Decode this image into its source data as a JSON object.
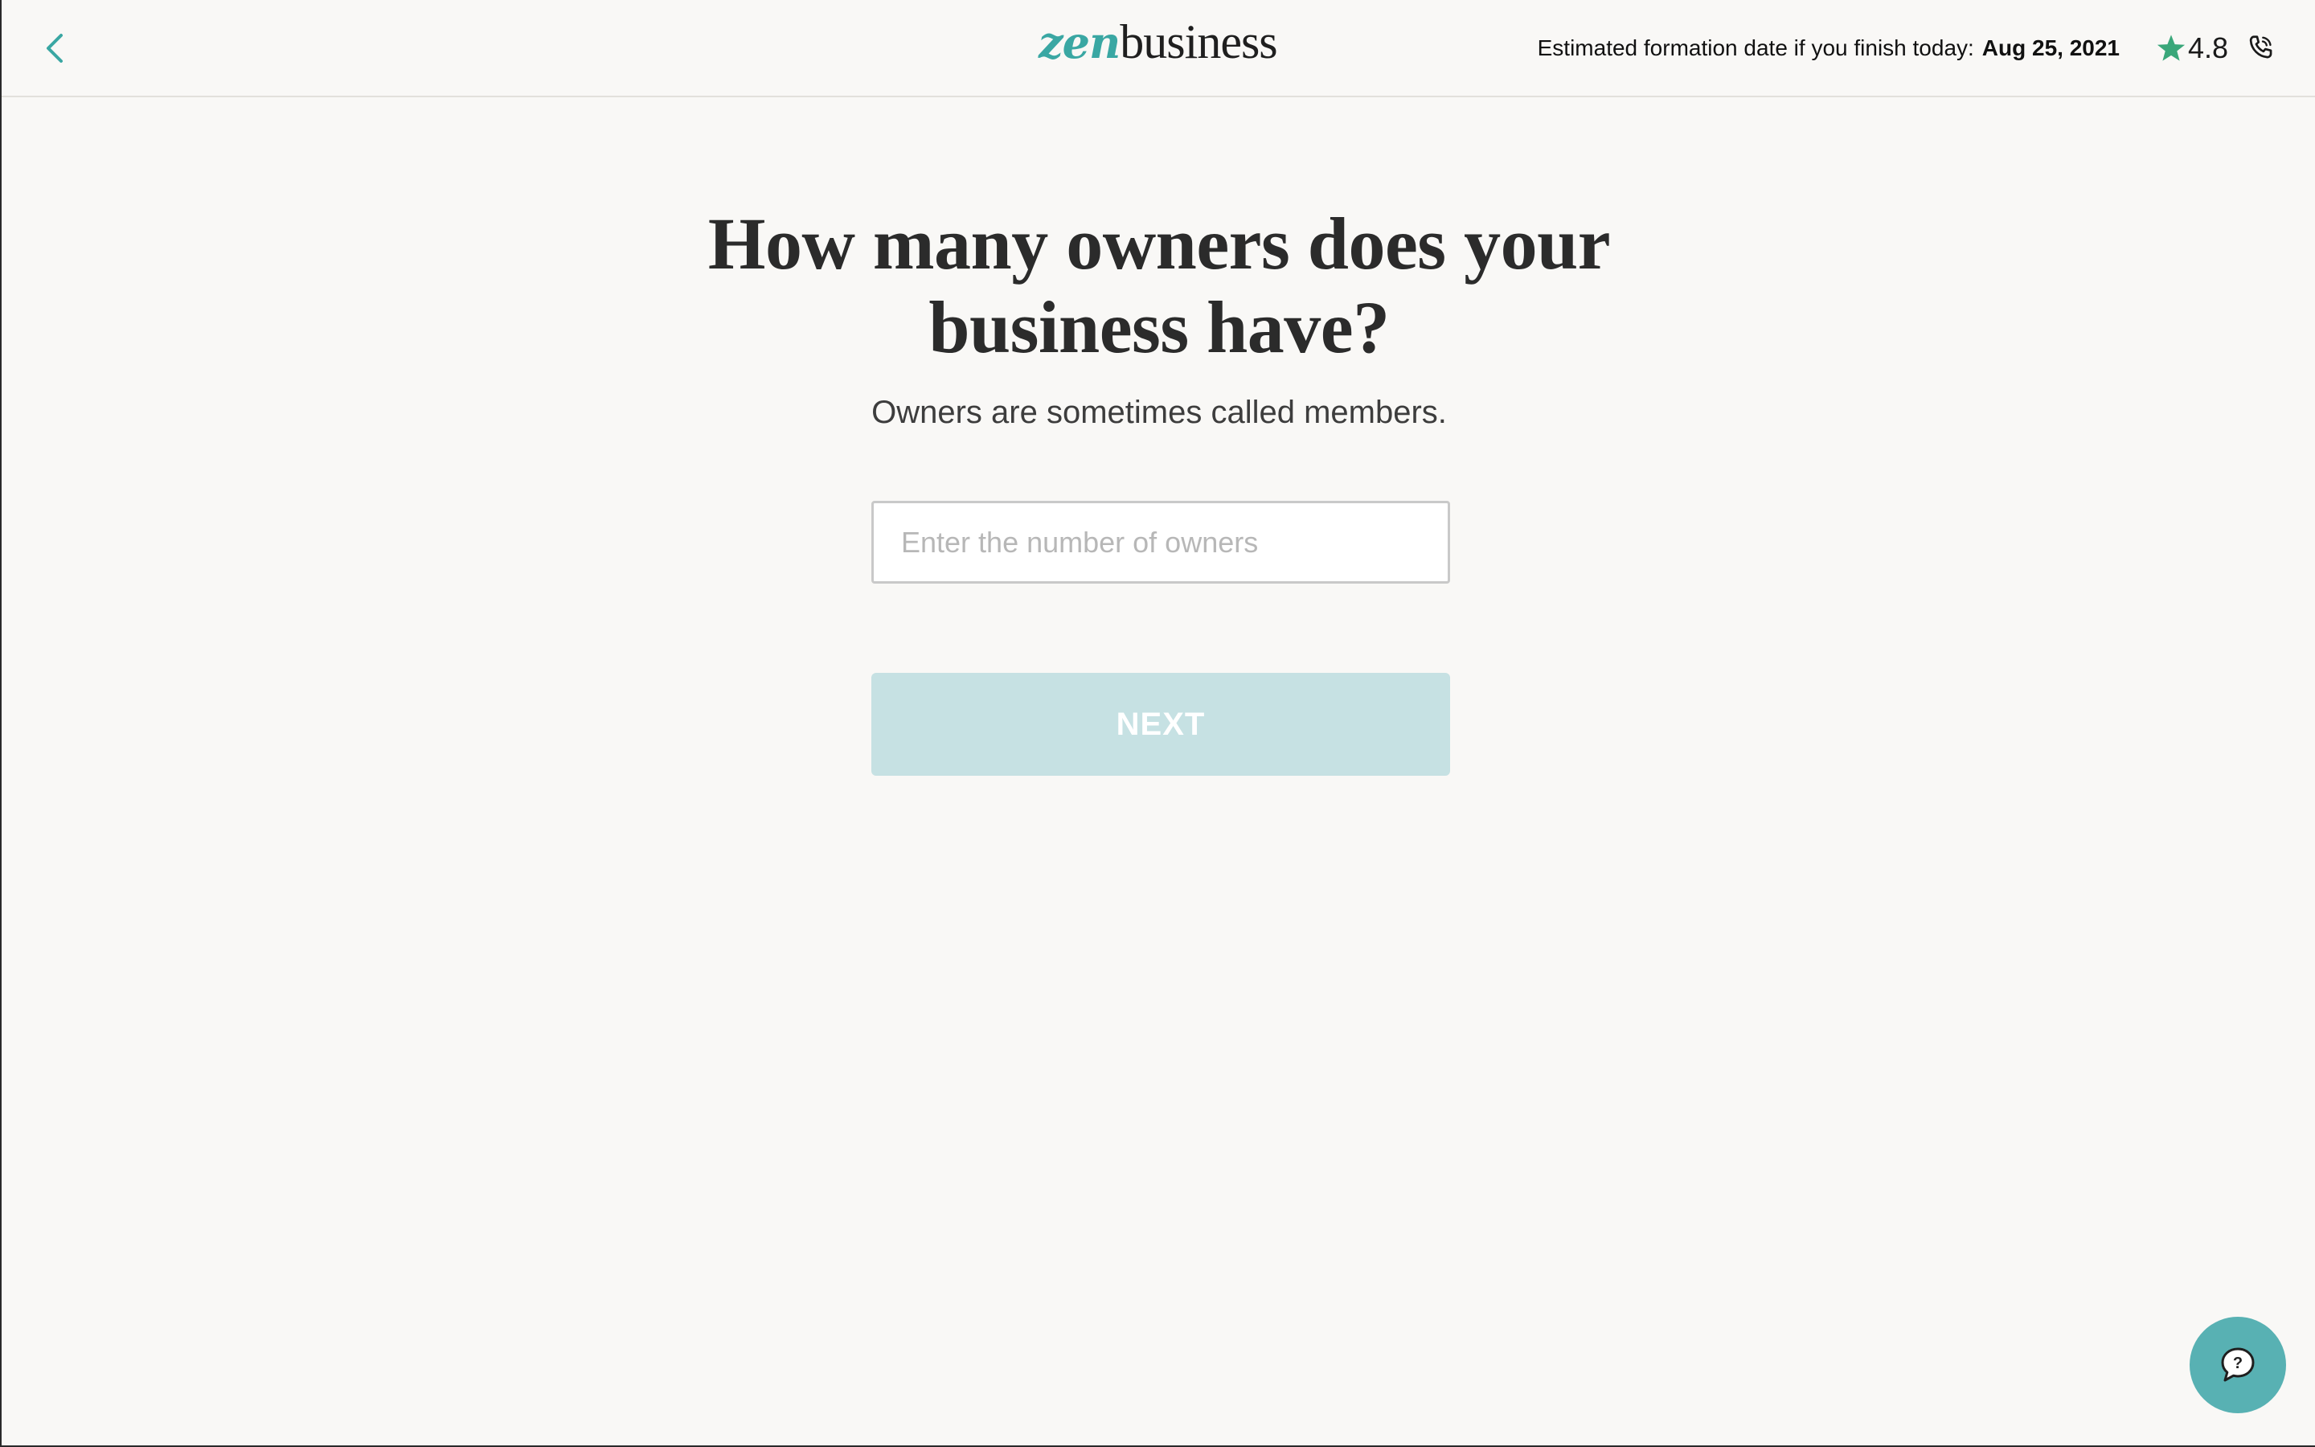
{
  "header": {
    "logo": {
      "part1": "zen",
      "part2": "business"
    },
    "formation_label": "Estimated formation date if you finish today:",
    "formation_date": "Aug 25, 2021",
    "rating": "4.8",
    "icons": {
      "back": "chevron-left-icon",
      "star": "star-icon",
      "phone": "phone-icon"
    }
  },
  "main": {
    "title": "How many owners does your business have?",
    "subtitle": "Owners are sometimes called members.",
    "input": {
      "placeholder": "Enter the number of owners",
      "value": ""
    },
    "next_label": "NEXT"
  },
  "help": {
    "icon": "chat-help-icon",
    "glyph": "?"
  },
  "colors": {
    "accent": "#3aa7a3",
    "button_disabled": "#c6e1e3",
    "background": "#f9f8f6",
    "star": "#3aa77a",
    "help_bubble": "#58b1b3"
  }
}
